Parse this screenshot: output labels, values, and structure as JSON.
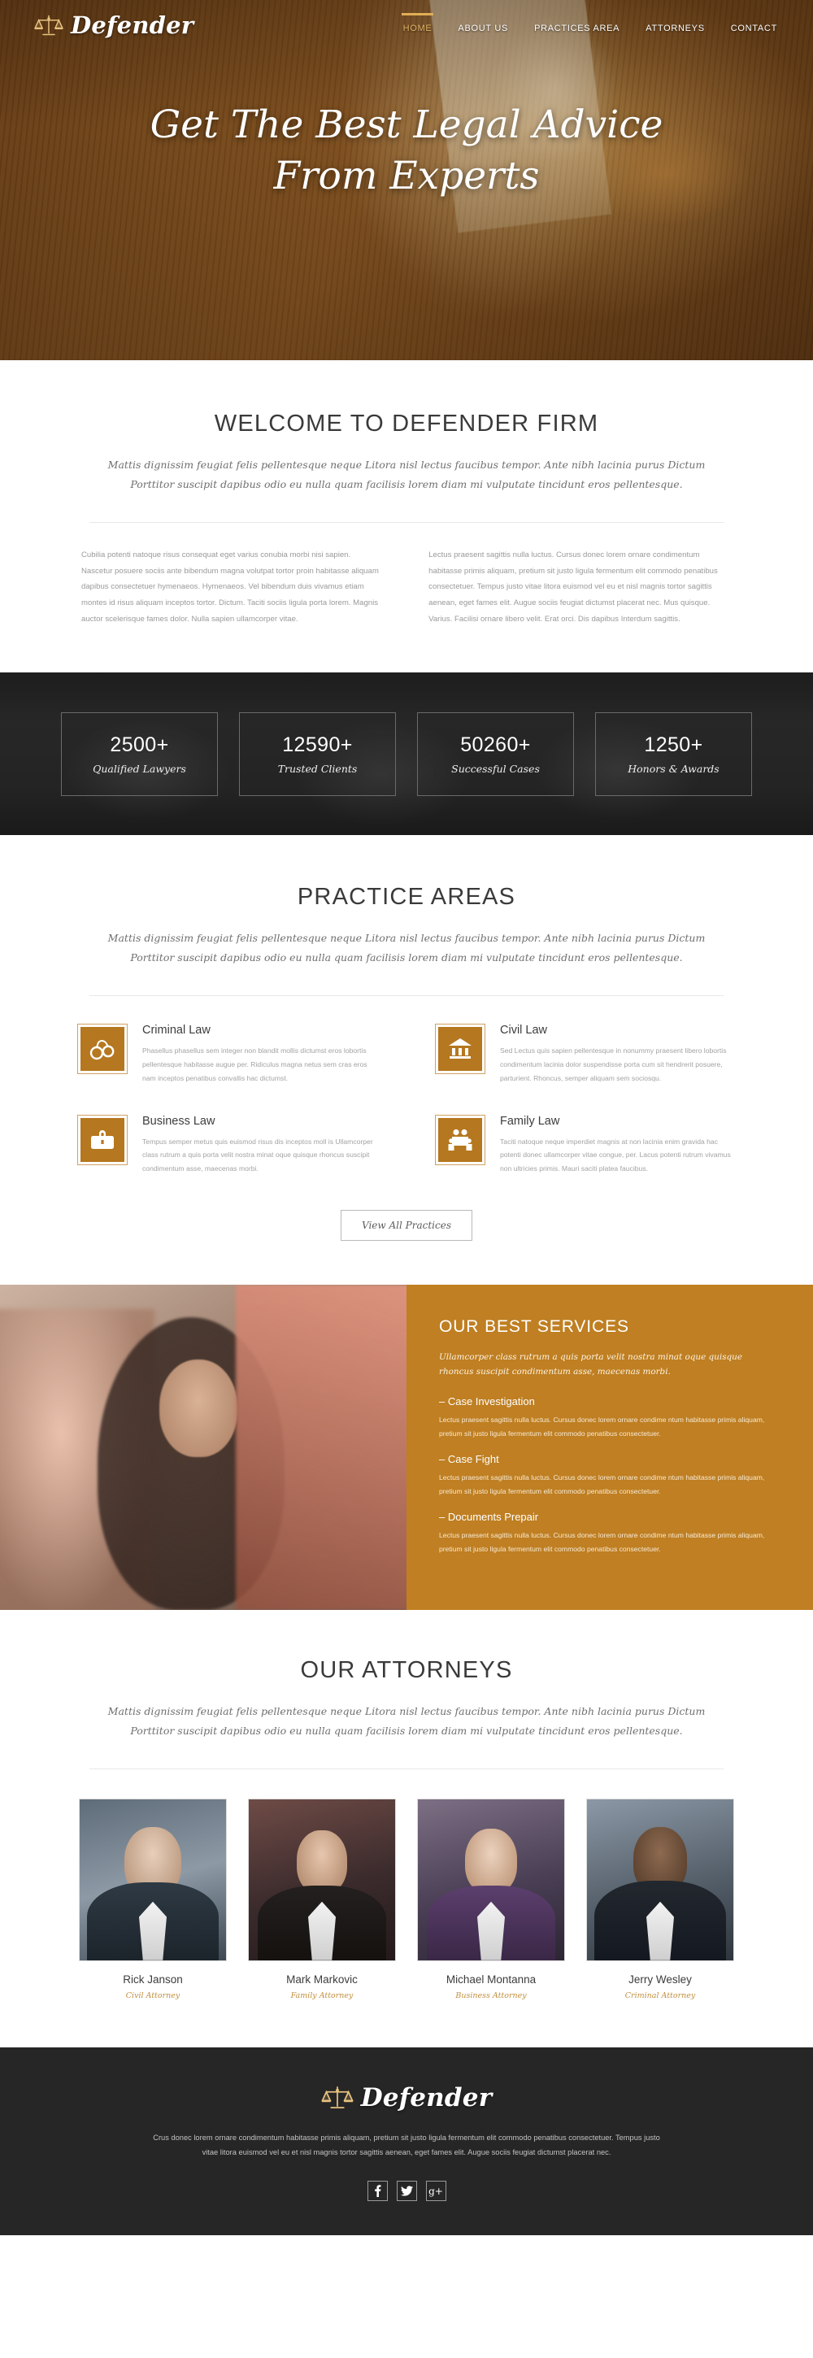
{
  "brand": {
    "name": "Defender",
    "icon": "scales-of-justice-icon"
  },
  "nav": {
    "items": [
      {
        "label": "HOME",
        "active": true
      },
      {
        "label": "ABOUT US",
        "active": false
      },
      {
        "label": "PRACTICES AREA",
        "active": false
      },
      {
        "label": "ATTORNEYS",
        "active": false
      },
      {
        "label": "CONTACT",
        "active": false
      }
    ]
  },
  "hero": {
    "line1": "Get The Best Legal Advice",
    "line2": "From Experts"
  },
  "welcome": {
    "title": "WELCOME TO DEFENDER FIRM",
    "subtitle": "Mattis dignissim feugiat felis pellentesque neque Litora nisl lectus faucibus tempor. Ante nibh lacinia purus Dictum Porttitor suscipit dapibus odio eu nulla quam facilisis lorem diam mi vulputate tincidunt eros pellentesque.",
    "col_left": "Cubilia potenti natoque risus consequat eget varius conubia morbi nisi sapien. Nascetur posuere sociis ante bibendum magna volutpat tortor proin habitasse aliquam dapibus consectetuer hymenaeos. Hymenaeos. Vel bibendum duis vivamus etiam montes id risus aliquam inceptos tortor. Dictum. Taciti sociis ligula porta lorem. Magnis auctor scelerisque fames dolor. Nulla sapien ullamcorper vitae.",
    "col_right": "Lectus praesent sagittis nulla luctus. Cursus donec lorem ornare condimentum habitasse primis aliquam, pretium sit justo ligula fermentum elit commodo penatibus consectetuer. Tempus justo vitae litora euismod vel eu et nisl magnis tortor sagittis aenean, eget fames elit. Augue sociis feugiat dictumst placerat nec. Mus quisque. Varius. Facilisi ornare libero velit. Erat orci. Dis dapibus Interdum sagittis."
  },
  "stats": [
    {
      "number": "2500+",
      "label": "Qualified Lawyers"
    },
    {
      "number": "12590+",
      "label": "Trusted Clients"
    },
    {
      "number": "50260+",
      "label": "Successful Cases"
    },
    {
      "number": "1250+",
      "label": "Honors & Awards"
    }
  ],
  "practice": {
    "title": "PRACTICE AREAS",
    "subtitle": "Mattis dignissim feugiat felis pellentesque neque Litora nisl lectus faucibus tempor. Ante nibh lacinia purus Dictum Porttitor suscipit dapibus odio eu nulla quam facilisis lorem diam mi vulputate tincidunt eros pellentesque.",
    "button": "View All Practices",
    "cards": [
      {
        "icon": "handcuffs-icon",
        "title": "Criminal Law",
        "text": "Phasellus phasellus sem integer non blandit mollis dictumst eros lobortis pellentesque habitasse augue per. Ridiculus magna netus sem cras eros nam inceptos penatibus convallis hac dictumst."
      },
      {
        "icon": "courthouse-icon",
        "title": "Civil Law",
        "text": "Sed Lectus quis sapien pellentesque in nonummy praesent libero lobortis condimentum lacinia dolor suspendisse porta cum sit hendrerit posuere, parturient. Rhoncus, semper aliquam sem sociosqu."
      },
      {
        "icon": "briefcase-icon",
        "title": "Business Law",
        "text": "Tempus semper metus quis euismod risus dis inceptos moll is Ullamcorper class rutrum a quis porta velit nostra minat oque quisque rhoncus suscipit condimentum asse, maecenas morbi."
      },
      {
        "icon": "family-icon",
        "title": "Family Law",
        "text": "Taciti natoque neque imperdiet magnis at non lacinia enim gravida hac potenti donec ullamcorper vitae congue, per. Lacus potenti rutrum vivamus non ultricies primis. Mauri saciti platea faucibus."
      }
    ]
  },
  "services": {
    "title": "OUR BEST SERVICES",
    "lead": "Ullamcorper class rutrum a quis porta velit nostra minat oque quisque rhoncus suscipit condimentum asse, maecenas morbi.",
    "items": [
      {
        "title": "– Case Investigation",
        "text": "Lectus praesent sagittis nulla luctus. Cursus donec lorem ornare condime ntum habitasse primis aliquam, pretium sit justo ligula fermentum elit commodo penatibus consectetuer."
      },
      {
        "title": "– Case Fight",
        "text": "Lectus praesent sagittis nulla luctus. Cursus donec lorem ornare condime ntum habitasse primis aliquam, pretium sit justo ligula fermentum elit commodo penatibus consectetuer."
      },
      {
        "title": "– Documents Prepair",
        "text": "Lectus praesent sagittis nulla luctus. Cursus donec lorem ornare condime ntum habitasse primis aliquam, pretium sit justo ligula fermentum elit commodo penatibus consectetuer."
      }
    ]
  },
  "attorneys": {
    "title": "OUR ATTORNEYS",
    "subtitle": "Mattis dignissim feugiat felis pellentesque neque Litora nisl lectus faucibus tempor. Ante nibh lacinia purus Dictum Porttitor suscipit dapibus odio eu nulla quam facilisis lorem diam mi vulputate tincidunt eros pellentesque.",
    "members": [
      {
        "name": "Rick Janson",
        "role": "Civil Attorney"
      },
      {
        "name": "Mark Markovic",
        "role": "Family Attorney"
      },
      {
        "name": "Michael Montanna",
        "role": "Business Attorney"
      },
      {
        "name": "Jerry Wesley",
        "role": "Criminal Attorney"
      }
    ]
  },
  "footer": {
    "brand": "Defender",
    "text": "Crus donec lorem ornare condimentum habitasse primis aliquam, pretium sit justo ligula fermentum elit commodo penatibus consectetuer. Tempus justo vitae litora euismod vel eu et nisl magnis tortor sagittis aenean, eget fames elit. Augue sociis feugiat dictumst placerat nec.",
    "socials": [
      {
        "name": "facebook-icon",
        "glyph": "f"
      },
      {
        "name": "twitter-icon",
        "glyph": "✉"
      },
      {
        "name": "googleplus-icon",
        "glyph": "g+"
      }
    ]
  },
  "colors": {
    "accent": "#b5771f",
    "services_bg": "#bf7f22",
    "dark": "#262626",
    "gold": "#e0ae55"
  }
}
